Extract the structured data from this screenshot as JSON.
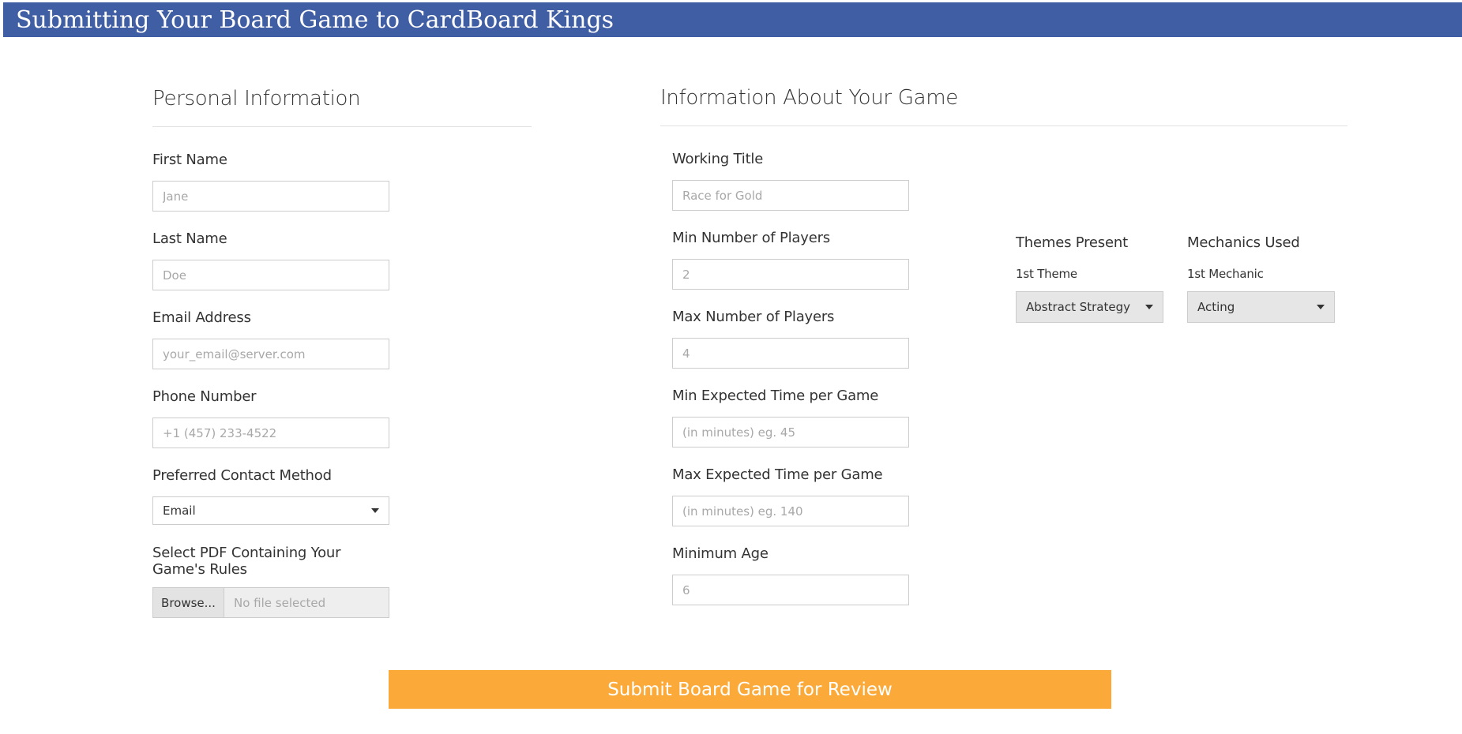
{
  "header": {
    "title": "Submitting Your Board Game to CardBoard Kings"
  },
  "personal": {
    "title": "Personal Information",
    "first_name": {
      "label": "First Name",
      "placeholder": "Jane"
    },
    "last_name": {
      "label": "Last Name",
      "placeholder": "Doe"
    },
    "email": {
      "label": "Email Address",
      "placeholder": "your_email@server.com"
    },
    "phone": {
      "label": "Phone Number",
      "placeholder": "+1 (457) 233-4522"
    },
    "contact_method": {
      "label": "Preferred Contact Method",
      "value": "Email"
    },
    "rules_pdf": {
      "label": "Select PDF Containing Your Game's Rules",
      "browse_label": "Browse...",
      "status": "No file selected"
    }
  },
  "game": {
    "title": "Information About Your Game",
    "working_title": {
      "label": "Working Title",
      "placeholder": "Race for Gold"
    },
    "min_players": {
      "label": "Min Number of Players",
      "placeholder": "2"
    },
    "max_players": {
      "label": "Max Number of Players",
      "placeholder": "4"
    },
    "min_time": {
      "label": "Min Expected Time per Game",
      "placeholder": "(in minutes) eg. 45"
    },
    "max_time": {
      "label": "Max Expected Time per Game",
      "placeholder": "(in minutes) eg. 140"
    },
    "min_age": {
      "label": "Minimum Age",
      "placeholder": "6"
    },
    "themes": {
      "label": "Themes Present",
      "sublabel": "1st Theme",
      "value": "Abstract Strategy"
    },
    "mechanics": {
      "label": "Mechanics Used",
      "sublabel": "1st Mechanic",
      "value": "Acting"
    }
  },
  "submit": {
    "label": "Submit Board Game for Review"
  },
  "colors": {
    "header": "#3f5ea3",
    "submit": "#fbaa3a"
  }
}
